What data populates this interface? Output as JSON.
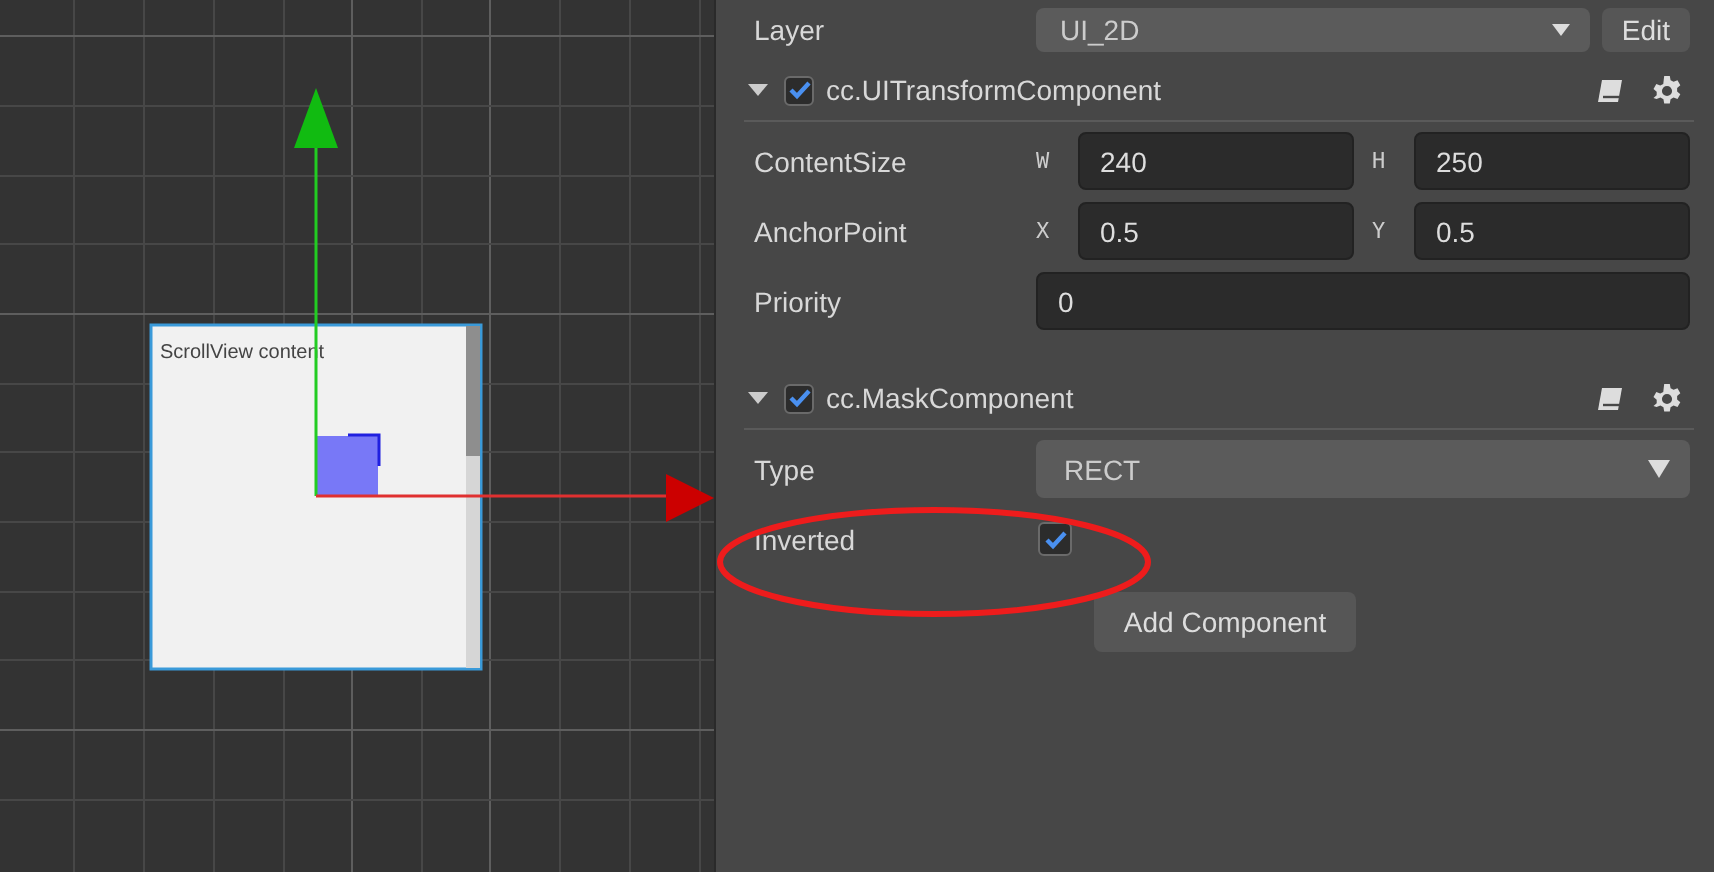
{
  "scene": {
    "node_label": "ScrollView content"
  },
  "layer": {
    "label": "Layer",
    "value": "UI_2D",
    "button": "Edit"
  },
  "components": [
    {
      "name": "cc.UITransformComponent",
      "expanded": true,
      "enabled": true,
      "properties": [
        {
          "kind": "pair",
          "label": "ContentSize",
          "fields": [
            {
              "axis": "W",
              "value": "240"
            },
            {
              "axis": "H",
              "value": "250"
            }
          ]
        },
        {
          "kind": "pair",
          "label": "AnchorPoint",
          "fields": [
            {
              "axis": "X",
              "value": "0.5"
            },
            {
              "axis": "Y",
              "value": "0.5"
            }
          ]
        },
        {
          "kind": "number",
          "label": "Priority",
          "value": "0"
        }
      ]
    },
    {
      "name": "cc.MaskComponent",
      "expanded": true,
      "enabled": true,
      "properties": [
        {
          "kind": "select",
          "label": "Type",
          "value": "RECT"
        },
        {
          "kind": "checkbox",
          "label": "Inverted",
          "checked": true
        }
      ]
    }
  ],
  "add_button": "Add Component"
}
